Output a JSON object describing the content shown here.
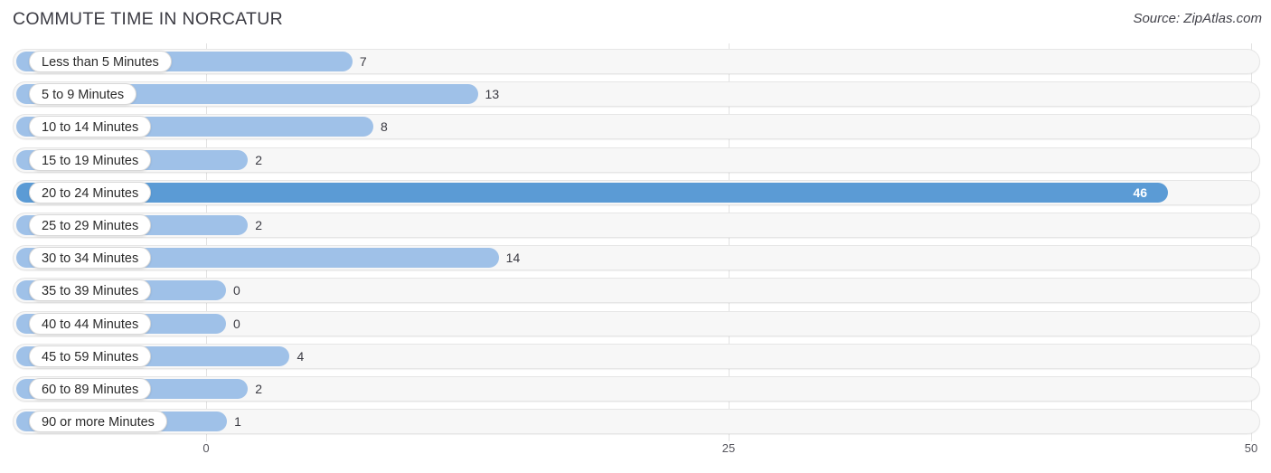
{
  "header": {
    "title": "COMMUTE TIME IN NORCATUR",
    "source": "Source: ZipAtlas.com"
  },
  "chart_data": {
    "type": "bar",
    "orientation": "horizontal",
    "title": "COMMUTE TIME IN NORCATUR",
    "xlabel": "",
    "ylabel": "",
    "xlim": [
      0,
      50
    ],
    "ticks": [
      "0",
      "25",
      "50"
    ],
    "tickValues": [
      0,
      25,
      50
    ],
    "grid": true,
    "legend": false,
    "highlight_index": 4,
    "colors": {
      "bar": "#9fc1e8",
      "bar_max": "#5b9bd5",
      "track": "#f7f7f7",
      "text": "#3a3a42"
    },
    "categories": [
      "Less than 5 Minutes",
      "5 to 9 Minutes",
      "10 to 14 Minutes",
      "15 to 19 Minutes",
      "20 to 24 Minutes",
      "25 to 29 Minutes",
      "30 to 34 Minutes",
      "35 to 39 Minutes",
      "40 to 44 Minutes",
      "45 to 59 Minutes",
      "60 to 89 Minutes",
      "90 or more Minutes"
    ],
    "values": [
      7,
      13,
      8,
      2,
      46,
      2,
      14,
      0,
      0,
      4,
      2,
      1
    ],
    "labels": [
      "7",
      "13",
      "8",
      "2",
      "46",
      "2",
      "14",
      "0",
      "0",
      "4",
      "2",
      "1"
    ]
  }
}
